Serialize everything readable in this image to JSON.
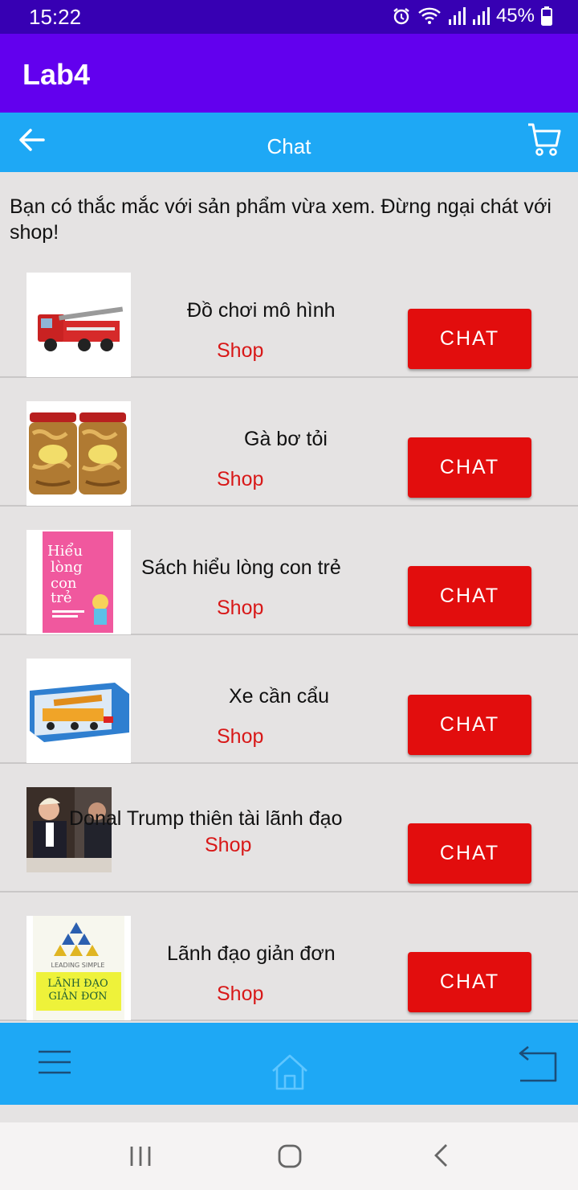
{
  "status_bar": {
    "time": "15:22",
    "battery": "45%"
  },
  "app": {
    "title": "Lab4"
  },
  "toolbar": {
    "title": "Chat"
  },
  "intro": "Bạn có thắc mắc với sản phẩm vừa xem. Đừng ngại chát với shop!",
  "products": [
    {
      "name": "Đồ chơi mô hình",
      "shop": "Shop",
      "chat": "CHAT",
      "thumb": "toy-fire-truck"
    },
    {
      "name": "Gà bơ tỏi",
      "shop": "Shop",
      "chat": "CHAT",
      "thumb": "garlic-chicken-jars"
    },
    {
      "name": "Sách hiểu lòng con trẻ",
      "shop": "Shop",
      "chat": "CHAT",
      "thumb": "pink-book-cover"
    },
    {
      "name": "Xe cần cẩu",
      "shop": "Shop",
      "chat": "CHAT",
      "thumb": "crane-toy-box"
    },
    {
      "name": "Donal Trump thiên tài lãnh đạo",
      "shop": "Shop",
      "chat": "CHAT",
      "thumb": "photo-two-men"
    },
    {
      "name": "Lãnh đạo giản đơn",
      "shop": "Shop",
      "chat": "CHAT",
      "thumb": "leading-simple-book"
    }
  ],
  "thumb_text": {
    "book1": [
      "Hiểu",
      "lòng",
      "con",
      "trẻ"
    ],
    "book6_top": "LEADING SIMPLE",
    "book6_title": [
      "LÃNH ĐẠO",
      "GIẢN ĐƠN"
    ]
  },
  "colors": {
    "app_bar": "#6200ee",
    "toolbar": "#1ea8f5",
    "chat_button": "#e20d0d",
    "shop_text": "#d81818"
  }
}
